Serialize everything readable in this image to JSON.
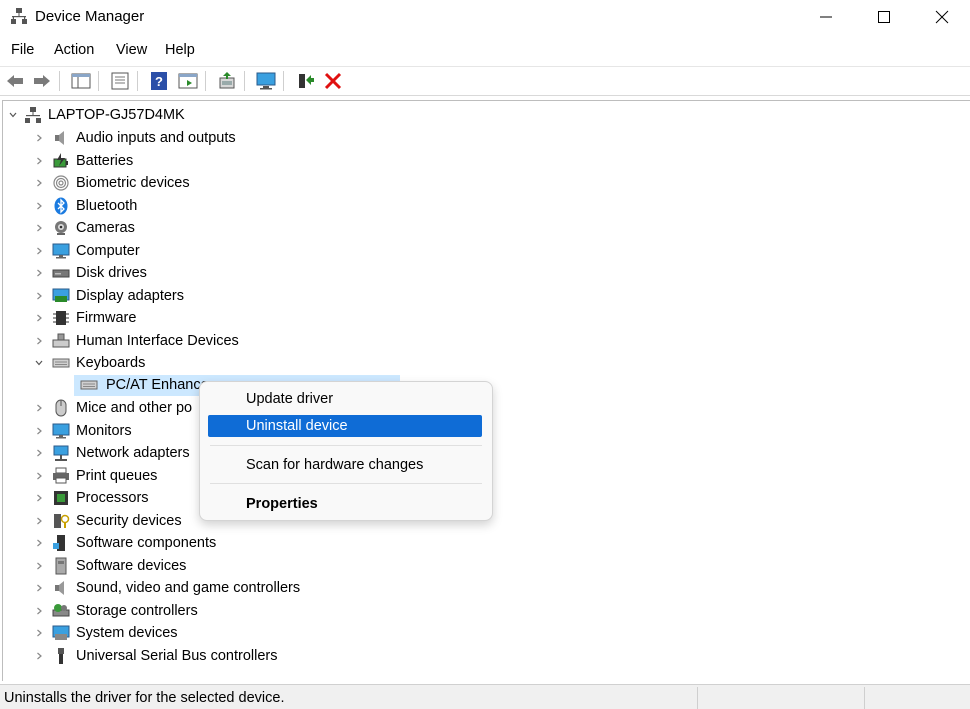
{
  "window": {
    "title": "Device Manager"
  },
  "menu": [
    "File",
    "Action",
    "View",
    "Help"
  ],
  "tree": {
    "root": "LAPTOP-GJ57D4MK",
    "categories": [
      {
        "label": "Audio inputs and outputs",
        "icon": "speaker-icon"
      },
      {
        "label": "Batteries",
        "icon": "battery-icon"
      },
      {
        "label": "Biometric devices",
        "icon": "fingerprint-icon"
      },
      {
        "label": "Bluetooth",
        "icon": "bluetooth-icon"
      },
      {
        "label": "Cameras",
        "icon": "camera-icon"
      },
      {
        "label": "Computer",
        "icon": "monitor-icon"
      },
      {
        "label": "Disk drives",
        "icon": "disk-drive-icon"
      },
      {
        "label": "Display adapters",
        "icon": "display-adapter-icon"
      },
      {
        "label": "Firmware",
        "icon": "firmware-icon"
      },
      {
        "label": "Human Interface Devices",
        "icon": "hid-icon"
      },
      {
        "label": "Keyboards",
        "icon": "keyboard-icon",
        "expanded": true
      },
      {
        "label": "Mice and other po",
        "icon": "mouse-icon"
      },
      {
        "label": "Monitors",
        "icon": "monitor-icon"
      },
      {
        "label": "Network adapters",
        "icon": "network-icon"
      },
      {
        "label": "Print queues",
        "icon": "printer-icon"
      },
      {
        "label": "Processors",
        "icon": "processor-icon"
      },
      {
        "label": "Security devices",
        "icon": "security-icon"
      },
      {
        "label": "Software components",
        "icon": "software-component-icon"
      },
      {
        "label": "Software devices",
        "icon": "software-device-icon"
      },
      {
        "label": "Sound, video and game controllers",
        "icon": "speaker-icon"
      },
      {
        "label": "Storage controllers",
        "icon": "storage-icon"
      },
      {
        "label": "System devices",
        "icon": "system-icon"
      },
      {
        "label": "Universal Serial Bus controllers",
        "icon": "usb-icon"
      }
    ],
    "keyboard_child": "PC/AT Enhance"
  },
  "context_menu": {
    "items": [
      "Update driver",
      "Uninstall device",
      "Scan for hardware changes",
      "Properties"
    ],
    "highlighted": "Uninstall device"
  },
  "status": {
    "text": "Uninstalls the driver for the selected device."
  },
  "colors": {
    "selection": "#cce8ff",
    "highlight": "#0f6cd6"
  }
}
